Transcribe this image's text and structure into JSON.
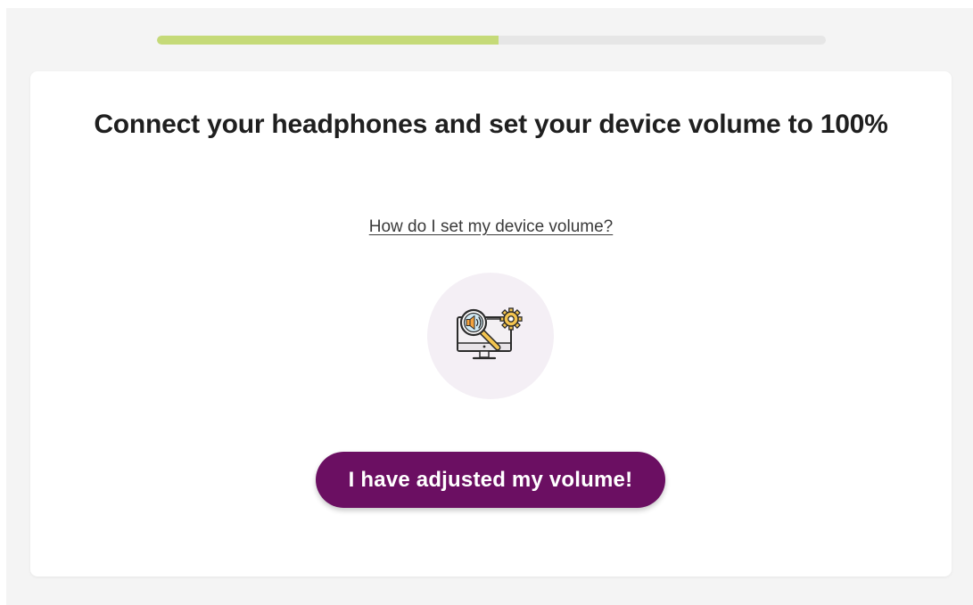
{
  "progress": {
    "value_percent": 51,
    "fill_color": "#c5da78",
    "track_color": "#e6e6e6"
  },
  "card": {
    "title": "Connect your headphones and set your device volume to 100%",
    "help_link": "How do I set my device volume?",
    "illustration": {
      "icon": "speaker-magnifier-gear-monitor-icon",
      "background_color": "#f4eff5"
    },
    "confirm_button": {
      "label": "I have adjusted my volume!",
      "color": "#6b0f62"
    }
  }
}
